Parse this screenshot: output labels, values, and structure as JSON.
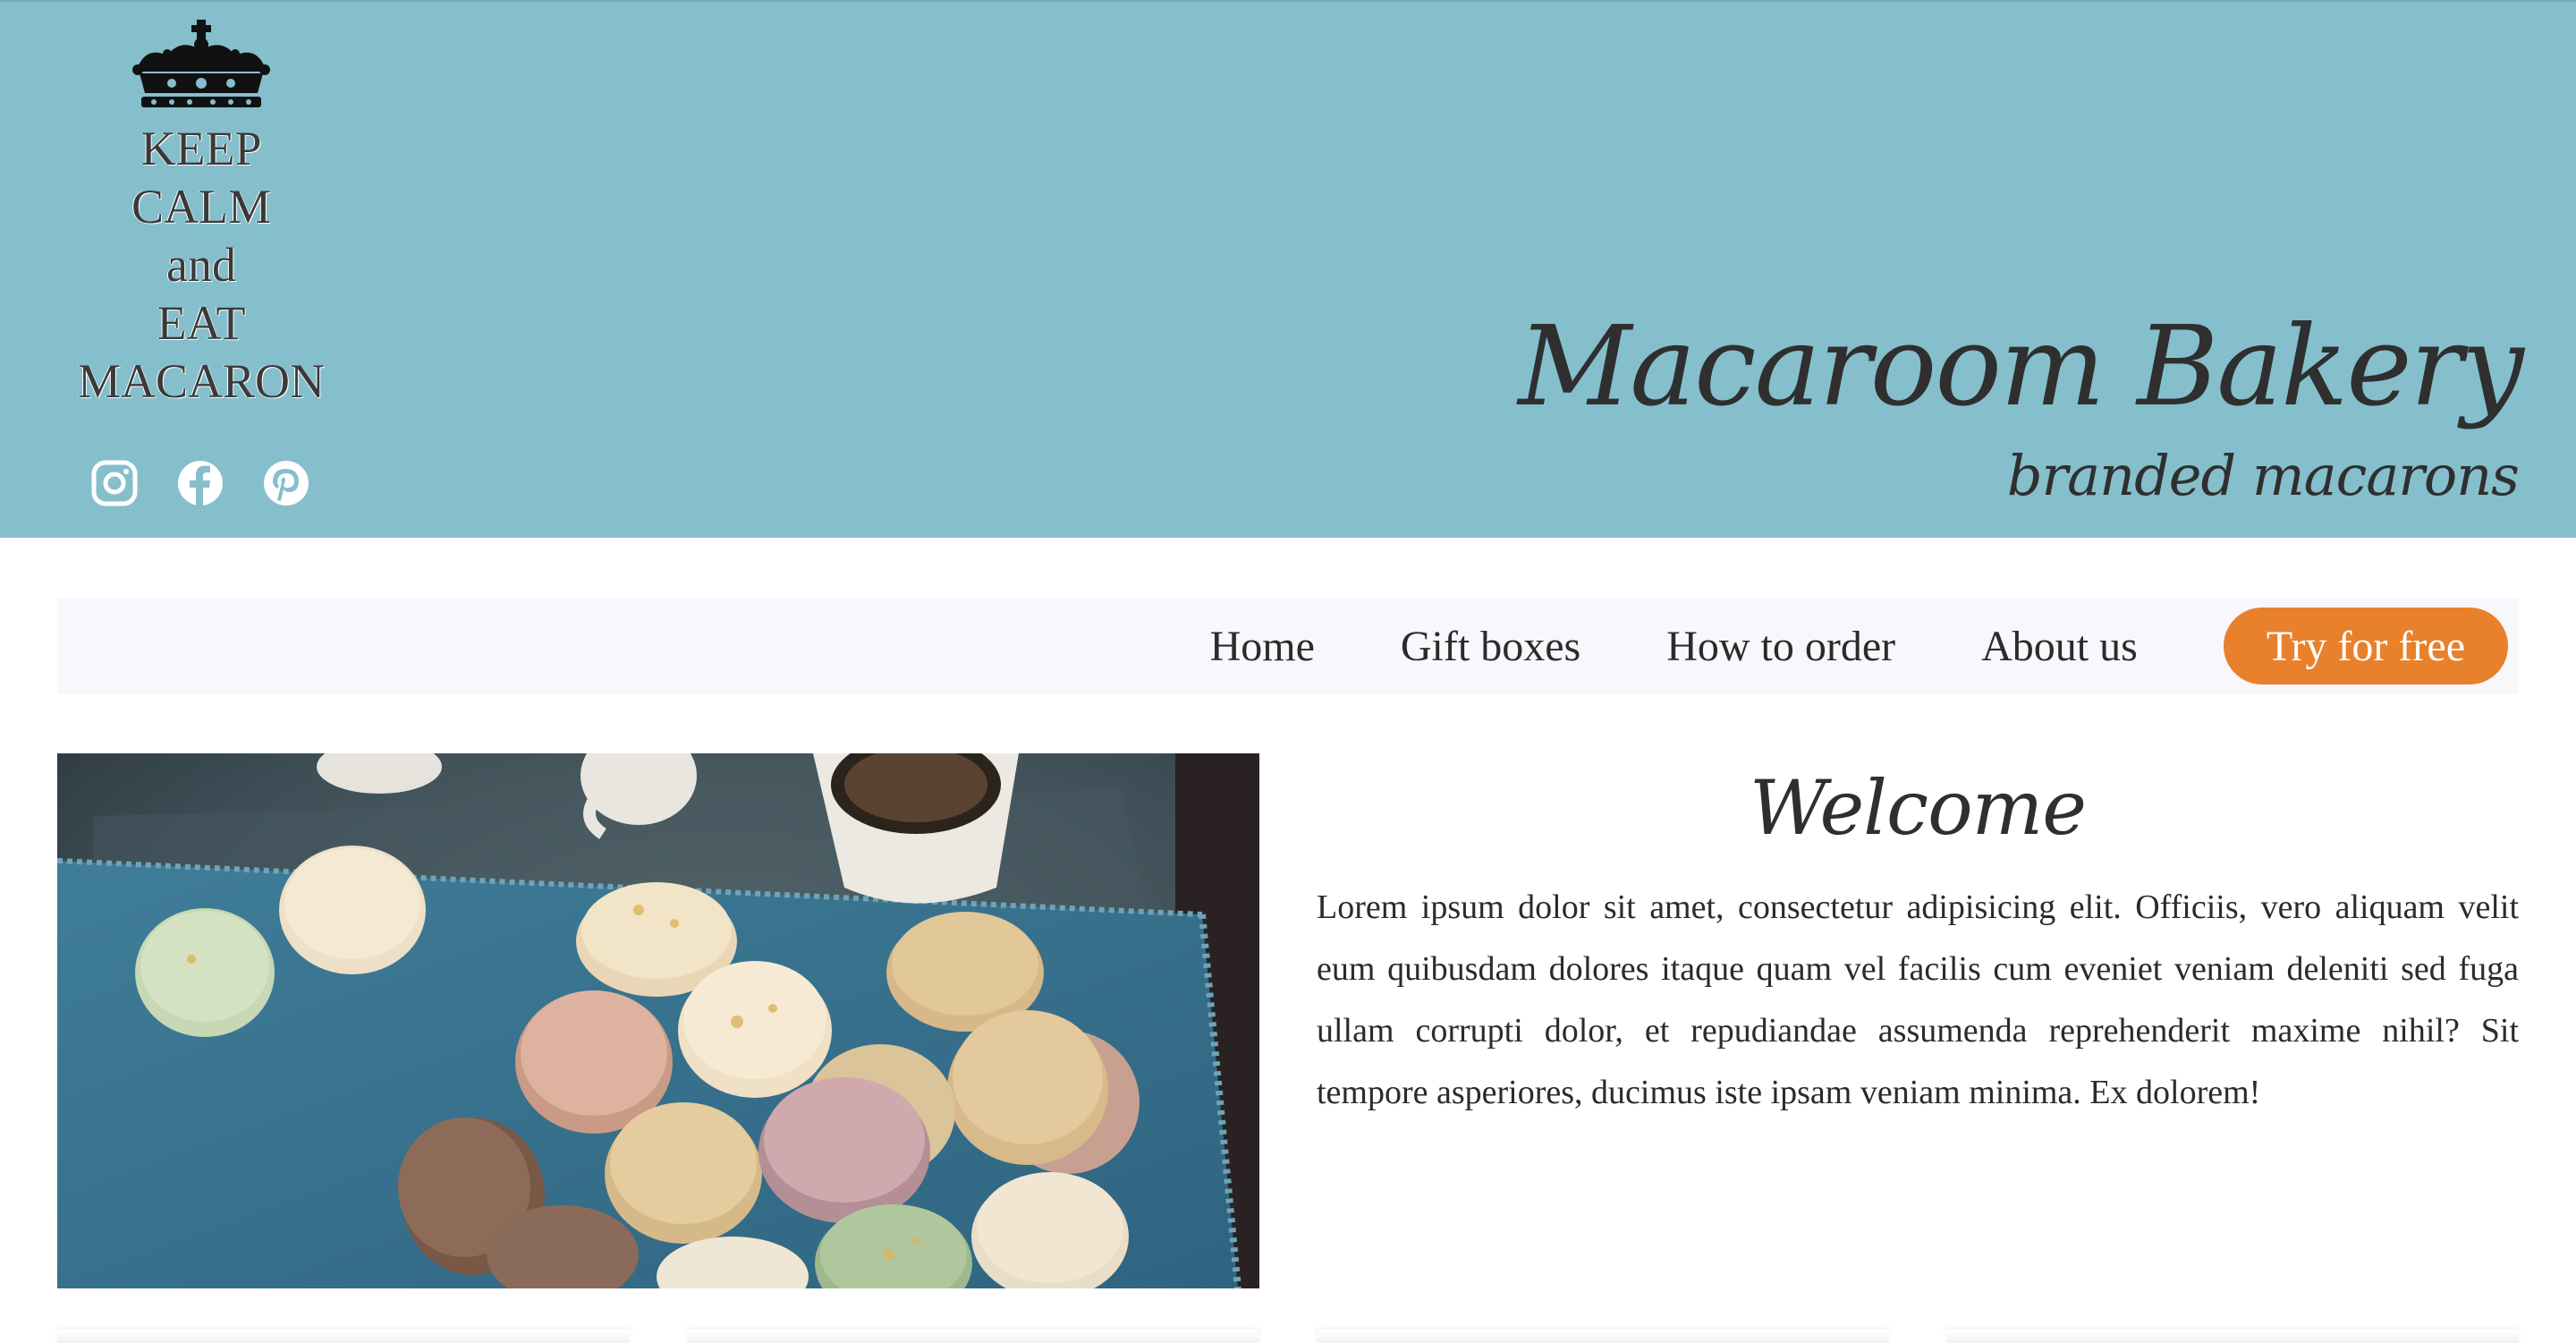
{
  "header": {
    "slogan_lines": [
      "KEEP",
      "CALM",
      "and",
      "EAT",
      "MACARON"
    ],
    "brand_title": "Macaroom Bakery",
    "brand_subtitle": "branded macarons",
    "background_color": "#85bfcc",
    "socials": [
      "instagram-icon",
      "facebook-icon",
      "pinterest-icon"
    ]
  },
  "nav": {
    "items": [
      {
        "label": "Home"
      },
      {
        "label": "Gift boxes"
      },
      {
        "label": "How to order"
      },
      {
        "label": "About us"
      }
    ],
    "cta_label": "Try for free",
    "cta_color": "#e8802c"
  },
  "main": {
    "hero_image": "macarons-on-blue-napkin-photo",
    "welcome_title": "Welcome",
    "welcome_text": "Lorem ipsum dolor sit amet, consectetur adipisicing elit. Officiis, vero aliquam velit eum quibusdam dolores itaque quam vel facilis cum eveniet veniam deleniti sed fuga ullam corrupti dolor, et repudiandae assumenda reprehenderit maxime nihil? Sit tempore asperiores, ducimus iste ipsam veniam minima. Ex dolorem!"
  }
}
